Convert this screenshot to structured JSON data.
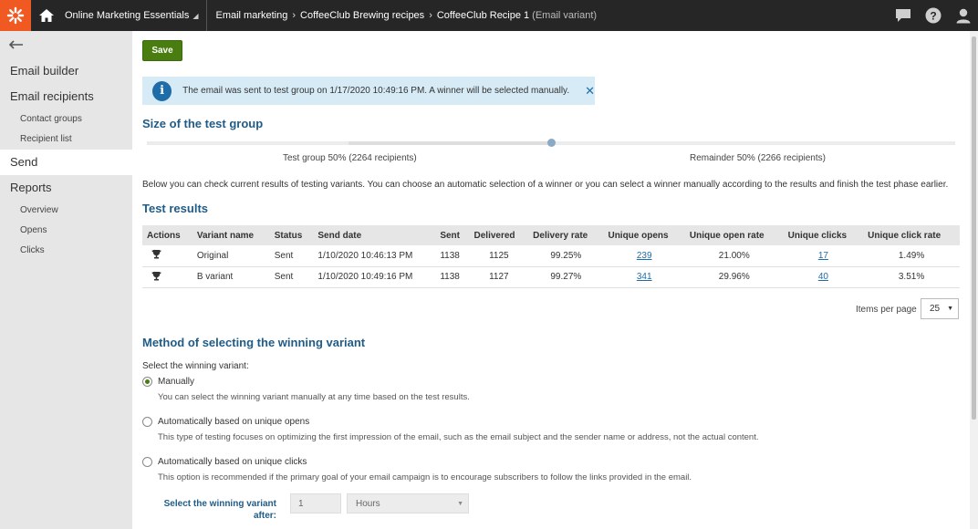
{
  "topbar": {
    "app_name": "Online Marketing Essentials",
    "breadcrumb": [
      "Email marketing",
      "CoffeeClub Brewing recipes",
      "CoffeeClub Recipe 1"
    ],
    "breadcrumb_suffix": "(Email variant)",
    "icons": [
      "chat-icon",
      "help-icon",
      "user-icon"
    ]
  },
  "sidebar": {
    "items": [
      {
        "label": "Email builder"
      },
      {
        "label": "Email recipients"
      },
      {
        "label": "Contact groups"
      },
      {
        "label": "Recipient list"
      },
      {
        "label": "Send"
      },
      {
        "label": "Reports"
      },
      {
        "label": "Overview"
      },
      {
        "label": "Opens"
      },
      {
        "label": "Clicks"
      }
    ]
  },
  "main": {
    "save_label": "Save",
    "info_message": "The email was sent to test group on 1/17/2020 10:49:16 PM. A winner will be selected manually.",
    "size_title": "Size of the test group",
    "slider": {
      "test_percent": 50
    },
    "test_group_label": "Test group 50% (2264 recipients)",
    "remainder_label": "Remainder 50% (2266 recipients)",
    "description": "Below you can check current results of testing variants. You can choose an automatic selection of a winner or you can select a winner manually according to the results and finish the test phase earlier.",
    "results_title": "Test results",
    "table": {
      "headers": [
        "Actions",
        "Variant name",
        "Status",
        "Send date",
        "Sent",
        "Delivered",
        "Delivery rate",
        "Unique opens",
        "Unique open rate",
        "Unique clicks",
        "Unique click rate"
      ],
      "rows": [
        {
          "variant": "Original",
          "status": "Sent",
          "date": "1/10/2020 10:46:13 PM",
          "sent": "1138",
          "delivered": "1125",
          "delivery_rate": "99.25%",
          "opens": "239",
          "open_rate": "21.00%",
          "clicks": "17",
          "click_rate": "1.49%"
        },
        {
          "variant": "B variant",
          "status": "Sent",
          "date": "1/10/2020 10:49:16 PM",
          "sent": "1138",
          "delivered": "1127",
          "delivery_rate": "99.27%",
          "opens": "341",
          "open_rate": "29.96%",
          "clicks": "40",
          "click_rate": "3.51%"
        }
      ]
    },
    "items_per_page_label": "Items per page",
    "items_per_page_value": "25",
    "method_title": "Method of selecting the winning variant",
    "select_label": "Select the winning variant:",
    "options": [
      {
        "label": "Manually",
        "desc": "You can select the winning variant manually at any time based on the test results."
      },
      {
        "label": "Automatically based on unique opens",
        "desc": "This type of testing focuses on optimizing the first impression of the email, such as the email subject and the sender name or address, not the actual content."
      },
      {
        "label": "Automatically based on unique clicks",
        "desc": "This option is recommended if the primary goal of your email campaign is to encourage subscribers to follow the links provided in the email."
      }
    ],
    "after_label": "Select the winning variant after:",
    "after_value": "1",
    "after_unit": "Hours"
  },
  "colors": {
    "brand": "#f05a22",
    "accent": "#1f5c88",
    "save": "#497d10",
    "info_bg": "#d6ebf5"
  }
}
